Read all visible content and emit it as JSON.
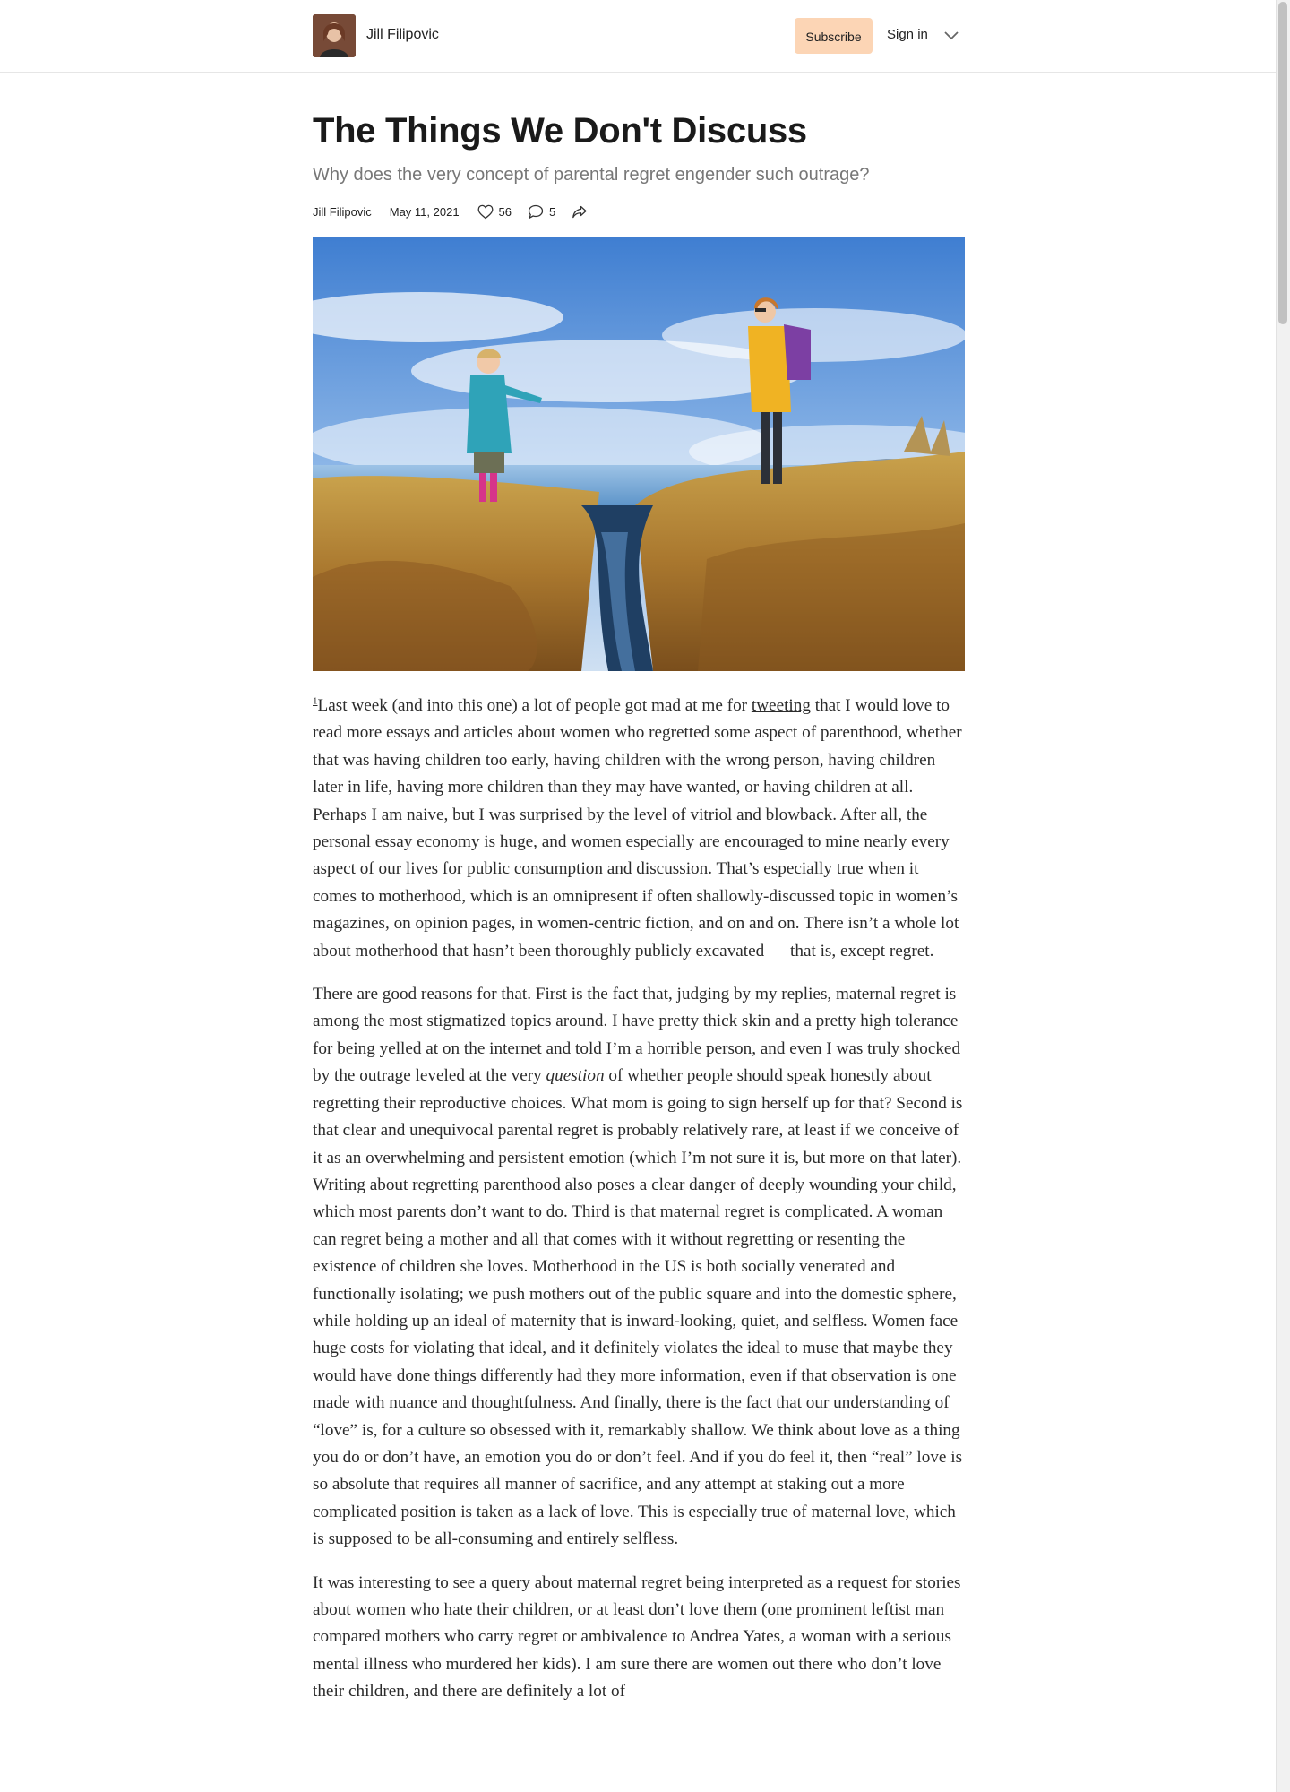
{
  "header": {
    "publication_name": "Jill Filipovic",
    "subscribe_label": "Subscribe",
    "signin_label": "Sign in"
  },
  "article": {
    "title": "The Things We Don't Discuss",
    "subtitle": "Why does the very concept of parental regret engender such outrage?",
    "author": "Jill Filipovic",
    "date": "May 11, 2021",
    "likes": "56",
    "comments": "5",
    "footnote_marker": "1",
    "p1_before_link": "Last week (and into this one) a lot of people got mad at me for ",
    "p1_link": "tweeting",
    "p1_after_link": " that I would love to read more essays and articles about women who regretted some aspect of parenthood, whether that was having children too early, having children with the wrong person, having children later in life, having more children than they may have wanted, or having children at all. Perhaps I am naive, but I was surprised by the level of vitriol and blowback. After all, the personal essay economy is huge, and women especially are encouraged to mine nearly every aspect of our lives for public consumption and discussion. That’s especially true when it comes to motherhood, which is an omnipresent if often shallowly-discussed topic in women’s magazines, on opinion pages, in women-centric fiction, and on and on. There isn’t a whole lot about motherhood that hasn’t been thoroughly publicly excavated — that is, except regret.",
    "p2_before_em": "There are good reasons for that. First is the fact that, judging by my replies, maternal regret is among the most stigmatized topics around. I have pretty thick skin and a pretty high tolerance for being yelled at on the internet and told I’m a horrible person, and even I was truly shocked by the outrage leveled at the very ",
    "p2_em": "question",
    "p2_after_em": " of whether people should speak honestly about regretting their reproductive choices. What mom is going to sign herself up for that? Second is that clear and unequivocal parental regret is probably relatively rare, at least if we conceive of it as an overwhelming and persistent emotion (which I’m not sure it is, but more on that later). Writing about regretting parenthood also poses a clear danger of deeply wounding your child, which most parents don’t want to do. Third is that maternal regret is complicated. A woman can regret being a mother and all that comes with it without regretting or resenting the existence of children she loves. Motherhood in the US is both socially venerated and functionally isolating; we push mothers out of the public square and into the domestic sphere, while holding up an ideal of maternity that is inward-looking, quiet, and selfless. Women face huge costs for violating that ideal, and it definitely violates the ideal to muse that maybe they would have done things differently had they more information, even if that observation is one made with nuance and thoughtfulness. And finally, there is the fact that our understanding of “love” is, for a culture so obsessed with it, remarkably shallow. We think about love as a thing you do or don’t have, an emotion you do or don’t feel. And if you do feel it, then “real” love is so absolute that requires all manner of sacrifice, and any attempt at staking out a more complicated position is taken as a lack of love. This is especially true of maternal love, which is supposed to be all-consuming and entirely selfless.",
    "p3": "It was interesting to see a query about maternal regret being interpreted as a request for stories about women who hate their children, or at least don’t love them (one prominent leftist man compared mothers who carry regret or ambivalence to Andrea Yates, a woman with a serious mental illness who murdered her kids). I am sure there are women out there who don’t love their children, and there are definitely a lot of"
  },
  "icons": {
    "like": "heart-icon",
    "comment": "comment-icon",
    "share": "share-icon",
    "menu": "chevron-down-icon"
  },
  "colors": {
    "subscribe_bg": "#fcd5b5",
    "subtitle": "#777777"
  }
}
